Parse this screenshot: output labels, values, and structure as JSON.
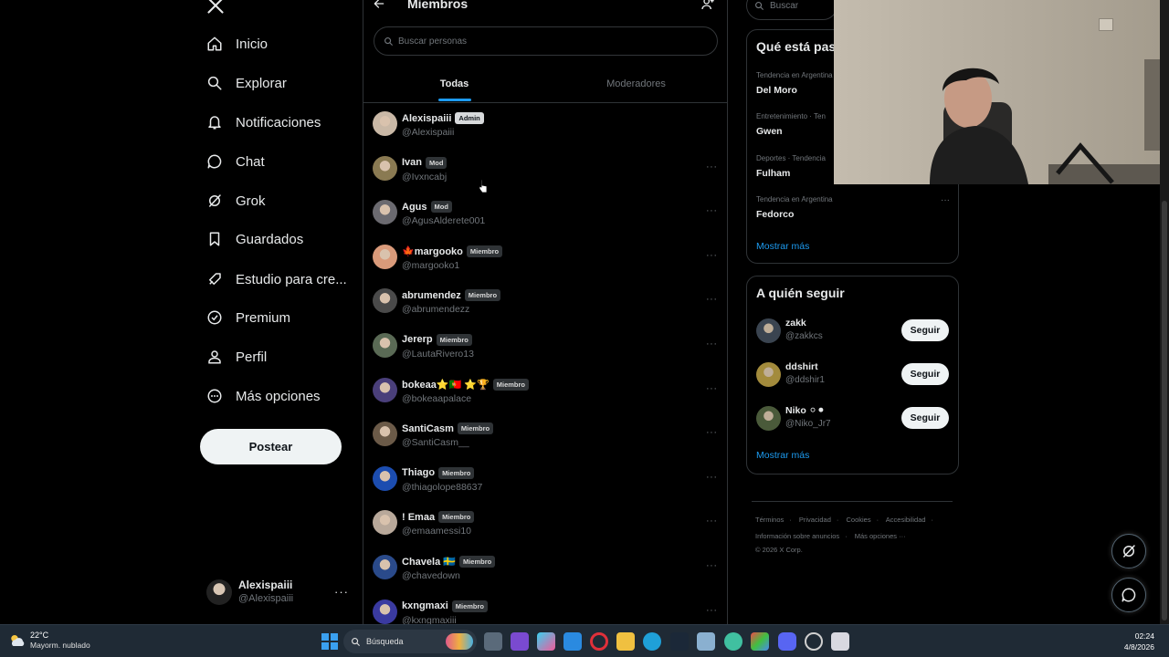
{
  "nav": {
    "items": [
      {
        "label": "Inicio",
        "icon": "home-icon"
      },
      {
        "label": "Explorar",
        "icon": "search-icon"
      },
      {
        "label": "Notificaciones",
        "icon": "bell-icon"
      },
      {
        "label": "Chat",
        "icon": "chat-icon"
      },
      {
        "label": "Grok",
        "icon": "grok-icon"
      },
      {
        "label": "Guardados",
        "icon": "bookmark-icon"
      },
      {
        "label": "Estudio para cre...",
        "icon": "rocket-icon"
      },
      {
        "label": "Premium",
        "icon": "verified-icon"
      },
      {
        "label": "Perfil",
        "icon": "person-icon"
      },
      {
        "label": "Más opciones",
        "icon": "more-circle-icon"
      }
    ],
    "post_label": "Postear",
    "account": {
      "name": "Alexispaiii",
      "handle": "@Alexispaiii"
    }
  },
  "center": {
    "title": "Miembros",
    "search_placeholder": "Buscar personas",
    "tabs": [
      {
        "label": "Todas",
        "active": true
      },
      {
        "label": "Moderadores",
        "active": false
      }
    ],
    "members": [
      {
        "name": "Alexispaiii",
        "badge": "Admin",
        "handle": "@Alexispaiii",
        "color": "#c9b8a6"
      },
      {
        "name": "Ivan",
        "badge": "Mod",
        "handle": "@Ivxncabj",
        "color": "#8a7a52"
      },
      {
        "name": "Agus",
        "badge": "Mod",
        "handle": "@AgusAlderete001",
        "color": "#6b6a70"
      },
      {
        "name": "🍁margooko",
        "badge": "Miembro",
        "handle": "@margooko1",
        "color": "#d99a7a"
      },
      {
        "name": "abrumendez",
        "badge": "Miembro",
        "handle": "@abrumendezz",
        "color": "#4a4a4a"
      },
      {
        "name": "Jererp",
        "badge": "Miembro",
        "handle": "@LautaRivero13",
        "color": "#5a6a55"
      },
      {
        "name": "bokeaa⭐🇵🇹 ⭐🏆",
        "badge": "Miembro",
        "handle": "@bokeaapalace",
        "color": "#4a3f7a"
      },
      {
        "name": "SantiCasm",
        "badge": "Miembro",
        "handle": "@SantiCasm__",
        "color": "#6b5a48"
      },
      {
        "name": "Thiago",
        "badge": "Miembro",
        "handle": "@thiagolope88637",
        "color": "#1c4db0"
      },
      {
        "name": "! Emaa",
        "badge": "Miembro",
        "handle": "@emaamessi10",
        "color": "#b8a89a"
      },
      {
        "name": "Chavela 🇸🇪",
        "badge": "Miembro",
        "handle": "@chavedown",
        "color": "#2a4a8a"
      },
      {
        "name": "kxngmaxi",
        "badge": "Miembro",
        "handle": "@kxngmaxiii",
        "color": "#3a3aa0"
      }
    ]
  },
  "right": {
    "search_placeholder": "Buscar",
    "trends_title": "Qué está pas",
    "trends": [
      {
        "meta": "Tendencia en Argentina",
        "topic": "Del Moro"
      },
      {
        "meta": "Entretenimiento · Ten",
        "topic": "Gwen"
      },
      {
        "meta": "Deportes · Tendencia",
        "topic": "Fulham"
      },
      {
        "meta": "Tendencia en Argentina",
        "topic": "Fedorco"
      }
    ],
    "trends_more": "Mostrar más",
    "who_title": "A quién seguir",
    "follow": [
      {
        "name": "zakk",
        "handle": "@zakkcs",
        "btn": "Seguir",
        "color": "#3a4450"
      },
      {
        "name": "ddshirt",
        "handle": "@ddshir1",
        "btn": "Seguir",
        "color": "#a38b3c"
      },
      {
        "name": "Niko ⚪⚫",
        "handle": "@Niko_Jr7",
        "btn": "Seguir",
        "color": "#4a5a3a"
      }
    ],
    "follow_more": "Mostrar más",
    "footer_row1": [
      "Términos",
      "Privacidad",
      "Cookies",
      "Accesibilidad"
    ],
    "footer_row2": [
      "Información sobre anuncios",
      "Más opciones ···"
    ],
    "copyright": "© 2026 X Corp."
  },
  "taskbar": {
    "temp": "22°C",
    "condition": "Mayorm. nublado",
    "search_label": "Búsqueda",
    "time": "02:24",
    "date": "4/8/2026"
  },
  "colors": {
    "accent": "#1d9bf0",
    "background": "#000000",
    "muted": "#71767b"
  }
}
